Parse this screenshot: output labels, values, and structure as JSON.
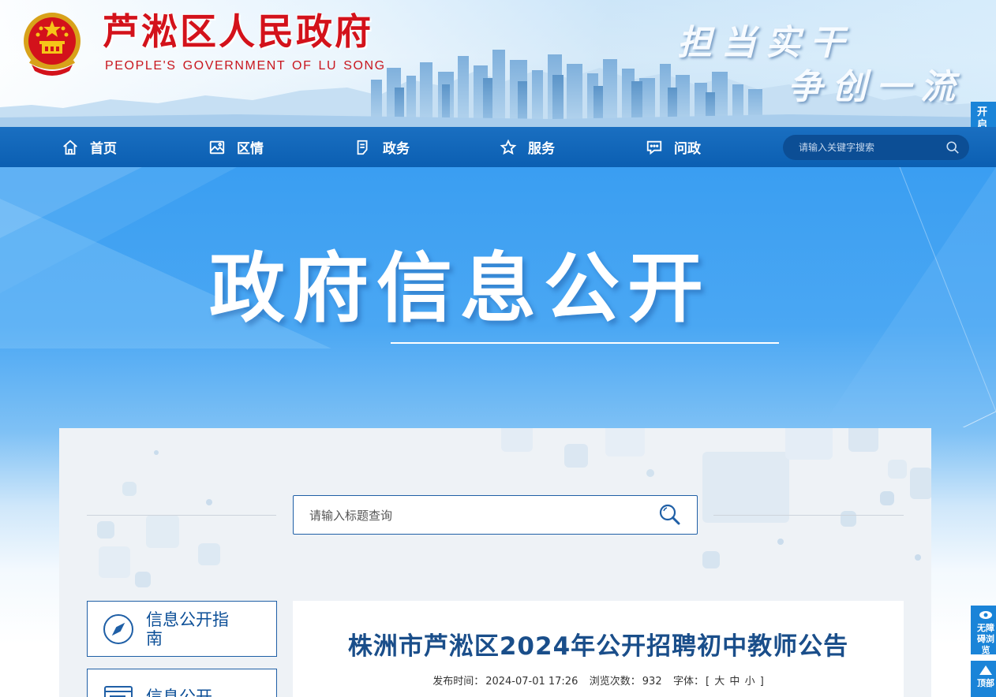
{
  "header": {
    "title": "芦淞区人民政府",
    "subtitle": "PEOPLE'S GOVERNMENT OF  LU SONG",
    "slogan_line1": "担当实干",
    "slogan_line2": "争创一流",
    "colors": {
      "title": "#d3121b",
      "nav": "#0b5fb2"
    }
  },
  "side_tabs": {
    "elder_mode": "开启适老模式",
    "accessible": "无障碍浏览",
    "top": "顶部"
  },
  "nav": {
    "items": [
      {
        "label": "首页",
        "icon": "home-icon"
      },
      {
        "label": "区情",
        "icon": "picture-icon"
      },
      {
        "label": "政务",
        "icon": "document-icon"
      },
      {
        "label": "服务",
        "icon": "star-icon"
      },
      {
        "label": "问政",
        "icon": "chat-icon"
      }
    ],
    "search_placeholder": "请输入关键字搜索"
  },
  "hero": {
    "title": "政府信息公开"
  },
  "content": {
    "search_placeholder": "请输入标题查询",
    "side_menu": [
      {
        "label": "信息公开指南",
        "icon": "compass-icon"
      },
      {
        "label": "信息公开",
        "icon": "catalog-icon"
      }
    ],
    "article": {
      "title": "株洲市芦淞区2024年公开招聘初中教师公告",
      "publish_label": "发布时间：",
      "publish_time": "2024-07-01 17:26",
      "views_label": "浏览次数：",
      "views": "932",
      "font_label": "字体：",
      "font_open": "[",
      "font_large": "大",
      "font_medium": "中",
      "font_small": "小",
      "font_close": "]"
    }
  }
}
